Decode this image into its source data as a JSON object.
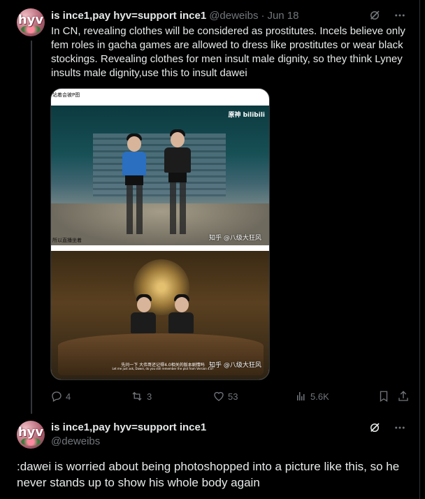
{
  "tweet1": {
    "avatar_text": "hyv",
    "display_name": "is ince1,pay hyv=support ince1",
    "handle": "@deweibs",
    "separator": "·",
    "date": "Jun 18",
    "icons": [
      "grok-icon",
      "more-icon"
    ],
    "text": "In CN, revealing clothes will be considered as prostitutes. Incels believe only fem roles in gacha games are allowed to dress like prostitutes or wear black stockings. Revealing clothes for men insult male dignity, so they think Lyney insults male dignity,use this to insult dawei",
    "media": {
      "caption_top": "站着会被P图",
      "caption_mid": "所以直播坐着",
      "watermark": "知乎 @八级大狂风",
      "bili_logo": "原神 bilibili",
      "subtitle_cn": "先问一下 大伟哥还记得4.0相关的版本剧情吗",
      "subtitle_en": "Let me just ask, Dawei, do you still remember the plot from Version 4.0?"
    },
    "actions": {
      "replies": "4",
      "reposts": "3",
      "likes": "53",
      "views": "5.6K"
    }
  },
  "tweet2": {
    "avatar_text": "hyv",
    "display_name": "is ince1,pay hyv=support ince1",
    "handle": "@deweibs",
    "text": ":dawei is worried about being photoshopped into a picture like this, so he never stands up to show his whole body again"
  },
  "colors": {
    "background": "#000000",
    "text": "#e7e9ea",
    "muted": "#71767b",
    "border": "#2f3336"
  }
}
